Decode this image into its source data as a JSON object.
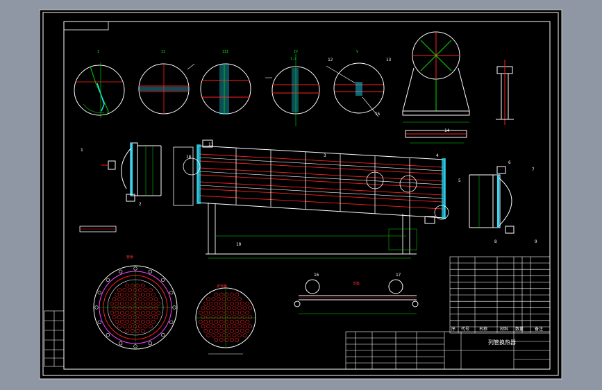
{
  "drawing": {
    "title_cn": "列管换热器",
    "bom_headers": [
      "序",
      "代号",
      "名称",
      "材料",
      "数量",
      "备注"
    ],
    "part_numbers": [
      "1",
      "2",
      "3",
      "4",
      "5",
      "6",
      "7",
      "8",
      "9",
      "10",
      "11",
      "12",
      "13",
      "14",
      "15",
      "16",
      "17",
      "18"
    ],
    "section_labels": [
      "I",
      "II",
      "III",
      "IV",
      "V"
    ],
    "scale_label": "1:2",
    "view_titles": [
      "管板",
      "折流板",
      "支座"
    ],
    "colors": {
      "frame": "#000000",
      "line_white": "#ffffff",
      "line_green": "#00e000",
      "line_red": "#ff2020",
      "line_magenta": "#ff40ff",
      "line_cyan": "#20e0ff",
      "outer_bg": "#8e97a3"
    }
  }
}
